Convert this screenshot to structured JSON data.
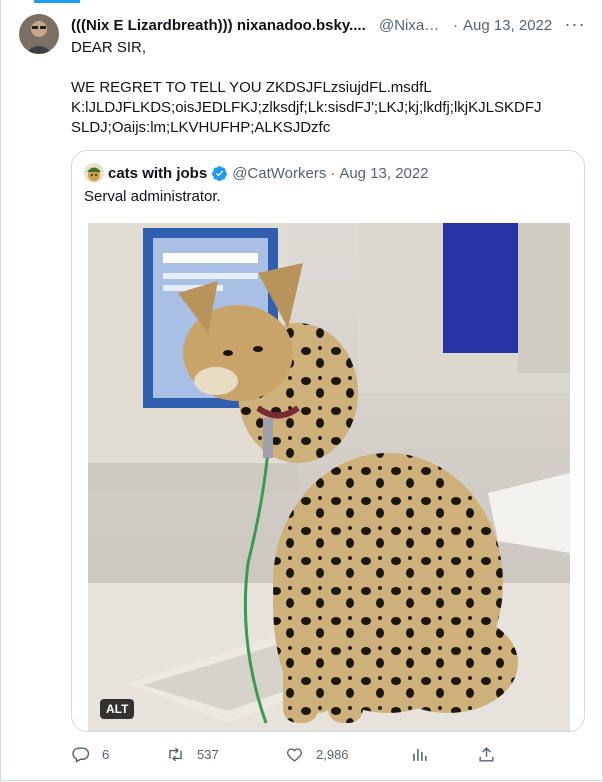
{
  "tweet": {
    "author_name": "(((Nix E Lizardbreath))) nixanadoo.bsky....",
    "author_handle": "@Nixan...",
    "separator": "·",
    "date": "Aug 13, 2022",
    "more_label": "···",
    "text_lines": [
      "DEAR SIR,",
      "",
      "WE REGRET TO TELL YOU ZKDSJFLzsiujdFL.msdfL",
      "K:lJLDJFLKDS;oisJEDLFKJ;zlksdjf;Lk:sisdFJ';LKJ;kj;lkdfj;lkjKJLSKDFJ",
      "SLDJ;Oaijs:lm;LKVHUFHP;ALKSJDzfc"
    ]
  },
  "quoted": {
    "author_name": "cats with jobs",
    "author_handle": "@CatWorkers",
    "separator": "·",
    "date": "Aug 13, 2022",
    "text": "Serval administrator.",
    "alt_badge": "ALT"
  },
  "actions": {
    "replies": "6",
    "retweets": "537",
    "likes": "2,986"
  },
  "colors": {
    "text": "#0f1419",
    "secondary": "#536471",
    "border": "#cfd9de",
    "accent": "#1d9bf0",
    "retweet_icon": "#536471"
  },
  "icons": {
    "reply": "reply-icon",
    "retweet": "retweet-icon",
    "like": "heart-icon",
    "analytics": "analytics-icon",
    "share": "share-icon",
    "verified": "verified-badge-icon"
  }
}
